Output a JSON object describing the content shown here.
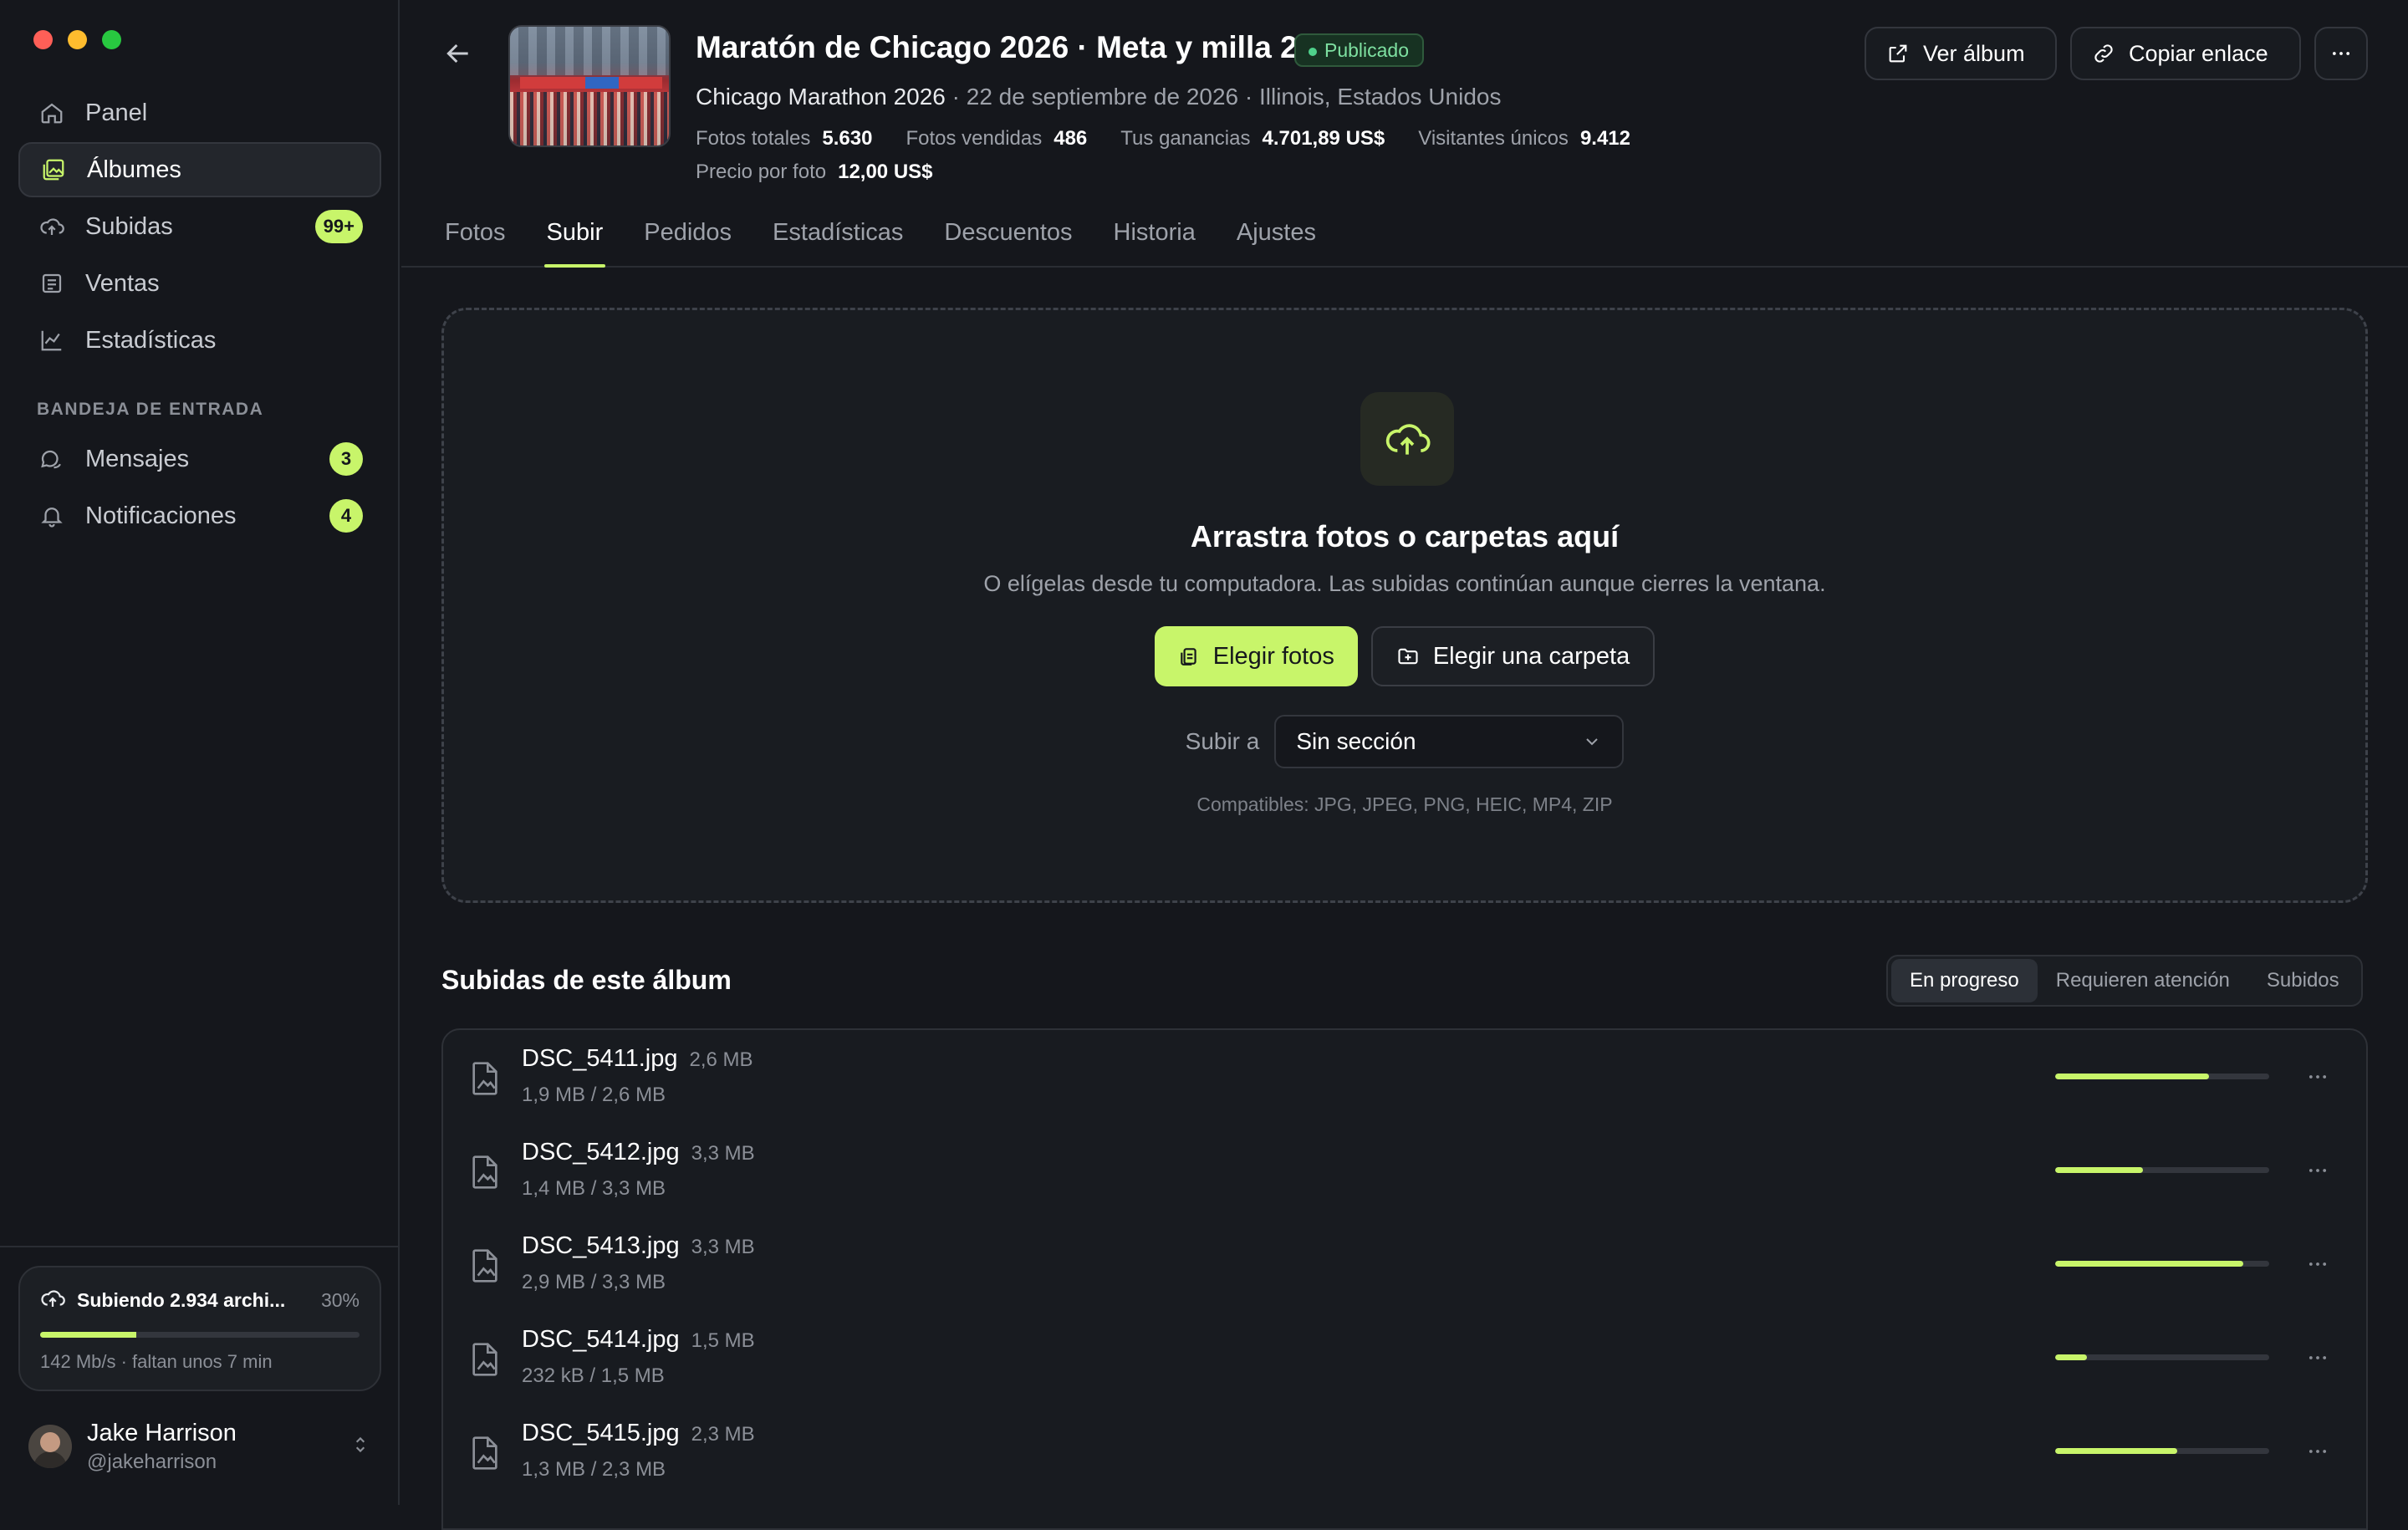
{
  "sidebar": {
    "nav": [
      {
        "label": "Panel",
        "icon": "home-icon"
      },
      {
        "label": "Álbumes",
        "icon": "album-icon",
        "active": true
      },
      {
        "label": "Subidas",
        "icon": "cloud-upload-icon",
        "badge": "99+"
      },
      {
        "label": "Ventas",
        "icon": "receipt-icon"
      },
      {
        "label": "Estadísticas",
        "icon": "chart-line-icon"
      }
    ],
    "inbox_heading": "BANDEJA DE ENTRADA",
    "inbox": [
      {
        "label": "Mensajes",
        "icon": "chat-icon",
        "badge": "3"
      },
      {
        "label": "Notificaciones",
        "icon": "bell-icon",
        "badge": "4"
      }
    ],
    "upload_status": {
      "title": "Subiendo 2.934 archi...",
      "percent_label": "30%",
      "progress": 0.3,
      "detail": "142 Mb/s · faltan unos 7 min"
    },
    "user": {
      "name": "Jake Harrison",
      "handle": "@jakeharrison"
    }
  },
  "album": {
    "title": "Maratón de Chicago 2026 · Meta y milla 25",
    "status": "Publicado",
    "event": "Chicago Marathon 2026",
    "date_location": " · 22 de septiembre de 2026 · Illinois, Estados Unidos",
    "stats": [
      {
        "label": "Fotos totales",
        "value": "5.630"
      },
      {
        "label": "Fotos vendidas",
        "value": "486"
      },
      {
        "label": "Tus ganancias",
        "value": "4.701,89 US$"
      },
      {
        "label": "Visitantes únicos",
        "value": "9.412"
      }
    ],
    "price_label": "Precio por foto",
    "price_value": "12,00 US$"
  },
  "header_actions": {
    "view": "Ver álbum",
    "copy": "Copiar enlace"
  },
  "tabs": [
    "Fotos",
    "Subir",
    "Pedidos",
    "Estadísticas",
    "Descuentos",
    "Historia",
    "Ajustes"
  ],
  "active_tab": "Subir",
  "dropzone": {
    "title": "Arrastra fotos o carpetas aquí",
    "subtitle": "O elígelas desde tu computadora. Las subidas continúan aunque cierres la ventana.",
    "choose_photos": "Elegir fotos",
    "choose_folder": "Elegir una carpeta",
    "target_label": "Subir a",
    "target_value": "Sin sección",
    "compatible": "Compatibles: JPG, JPEG, PNG, HEIC, MP4, ZIP"
  },
  "uploads": {
    "title": "Subidas de este álbum",
    "filters": [
      "En progreso",
      "Requieren atención",
      "Subidos"
    ],
    "active_filter": "En progreso",
    "files": [
      {
        "name": "DSC_5411.jpg",
        "size": "2,6 MB",
        "progress_text": "1,9 MB / 2,6 MB",
        "progress": 0.72
      },
      {
        "name": "DSC_5412.jpg",
        "size": "3,3 MB",
        "progress_text": "1,4 MB / 3,3 MB",
        "progress": 0.41
      },
      {
        "name": "DSC_5413.jpg",
        "size": "3,3 MB",
        "progress_text": "2,9 MB / 3,3 MB",
        "progress": 0.88
      },
      {
        "name": "DSC_5414.jpg",
        "size": "1,5 MB",
        "progress_text": "232 kB / 1,5 MB",
        "progress": 0.15
      },
      {
        "name": "DSC_5415.jpg",
        "size": "2,3 MB",
        "progress_text": "1,3 MB / 2,3 MB",
        "progress": 0.57
      }
    ]
  },
  "colors": {
    "accent": "#c8f56a",
    "published": "#4fd18b"
  }
}
